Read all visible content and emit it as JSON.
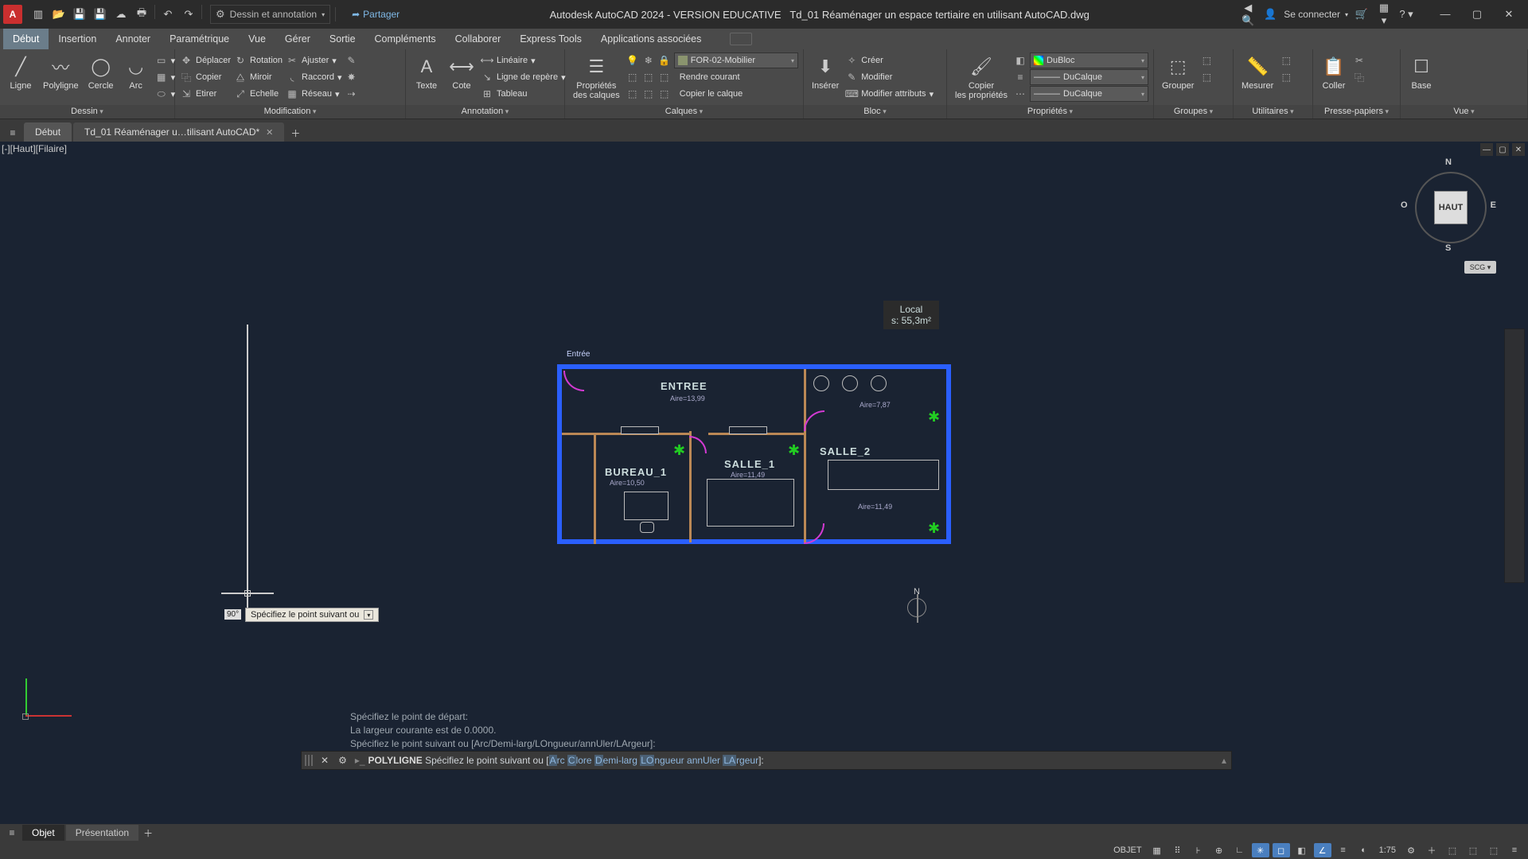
{
  "title": {
    "app": "Autodesk AutoCAD 2024 - VERSION EDUCATIVE",
    "file": "Td_01 Réaménager un espace tertiaire en utilisant AutoCAD.dwg",
    "logo": "A"
  },
  "workspace": "Dessin et annotation",
  "share": "Partager",
  "signin": "Se connecter",
  "menubar": [
    "Début",
    "Insertion",
    "Annoter",
    "Paramétrique",
    "Vue",
    "Gérer",
    "Sortie",
    "Compléments",
    "Collaborer",
    "Express Tools",
    "Applications associées"
  ],
  "ribbon": {
    "dessin": {
      "title": "Dessin",
      "ligne": "Ligne",
      "polyligne": "Polyligne",
      "cercle": "Cercle",
      "arc": "Arc"
    },
    "modif": {
      "title": "Modification",
      "deplacer": "Déplacer",
      "rotation": "Rotation",
      "ajuster": "Ajuster",
      "copier": "Copier",
      "miroir": "Miroir",
      "raccord": "Raccord",
      "etirer": "Etirer",
      "echelle": "Echelle",
      "reseau": "Réseau"
    },
    "annot": {
      "title": "Annotation",
      "texte": "Texte",
      "cote": "Cote",
      "lineaire": "Linéaire",
      "repere": "Ligne de repère",
      "tableau": "Tableau"
    },
    "calques": {
      "title": "Calques",
      "prop": "Propriétés\ndes calques",
      "layer": "FOR-02-Mobilier",
      "rendre": "Rendre courant",
      "copier": "Copier le calque"
    },
    "bloc": {
      "title": "Bloc",
      "inserer": "Insérer",
      "creer": "Créer",
      "modifier": "Modifier",
      "modattr": "Modifier attributs"
    },
    "props": {
      "title": "Propriétés",
      "copier": "Copier\nles propriétés",
      "bylayer": "DuBloc",
      "linetype": "DuCalque",
      "lineweight": "DuCalque"
    },
    "groupes": {
      "title": "Groupes",
      "grouper": "Grouper"
    },
    "util": {
      "title": "Utilitaires",
      "mesurer": "Mesurer"
    },
    "clip": {
      "title": "Presse-papiers",
      "coller": "Coller"
    },
    "vue": {
      "title": "Vue",
      "base": "Base"
    }
  },
  "doctabs": {
    "debut": "Début",
    "file": "Td_01 Réaménager u…tilisant AutoCAD*"
  },
  "viewport": {
    "label": "[-][Haut][Filaire]"
  },
  "viewcube": {
    "face": "HAUT",
    "n": "N",
    "s": "S",
    "e": "E",
    "o": "O",
    "scg": "SCG ▾"
  },
  "plan": {
    "entree_small": "Entrée",
    "entree": "ENTREE",
    "entree_area": "Aire=13,99",
    "bureau": "BUREAU_1",
    "bureau_area": "Aire=10,50",
    "salle1": "SALLE_1",
    "salle1_area": "Aire=11,49",
    "salle2": "SALLE_2",
    "salle2_area": "Aire=11,49",
    "wc_area": "Aire=7,87",
    "local": "Local",
    "local_area": "s: 55,3m²"
  },
  "dynamic": {
    "angle": "90°",
    "tip": "Spécifiez le point suivant ou"
  },
  "cmd": {
    "h1": "Spécifiez le point de départ:",
    "h2": "La largeur courante est de 0.0000.",
    "h3": "Spécifiez le point suivant ou [Arc/Demi-larg/LOngueur/annUler/LArgeur]:",
    "cmd": "POLYLIGNE",
    "prompt": "Spécifiez le point suivant ou [",
    "a": "A",
    "rc": "rc ",
    "c": "C",
    "lore": "lore ",
    "d": "D",
    "emi": "emi-larg ",
    "lo": "LO",
    "ngueur": "ngueur ",
    "u": "annU",
    "ler": "ler ",
    "la": "LA",
    "rgeur": "rgeur",
    "end": "]:"
  },
  "btabs": {
    "objet": "Objet",
    "pres": "Présentation"
  },
  "status": {
    "objet": "OBJET",
    "scale": "1:75"
  }
}
